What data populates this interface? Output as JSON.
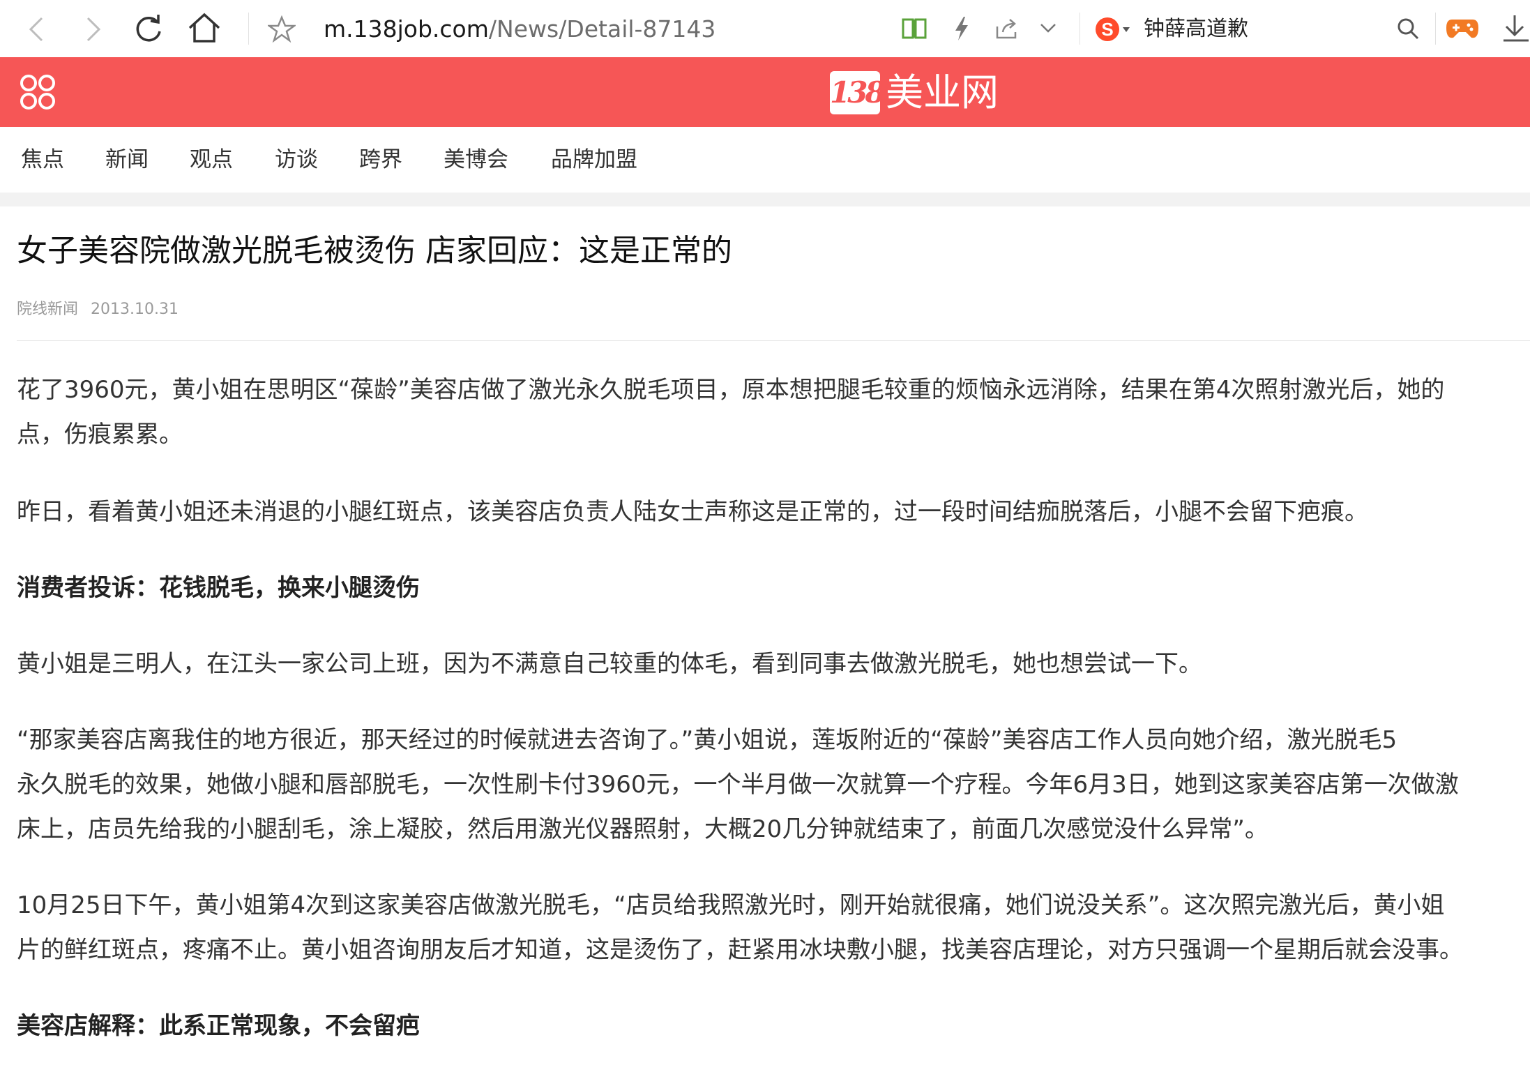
{
  "browser": {
    "url_host": "m.138job.com",
    "url_path": "/News/Detail-87143",
    "search_suggestion": "钟薛高道歉",
    "search_engine_icon": "sogou-s-icon",
    "icons": [
      "back-icon",
      "forward-icon",
      "reload-icon",
      "home-icon",
      "star-icon",
      "reader-icon",
      "lightning-icon",
      "share-icon",
      "chevron-down-icon",
      "search-icon",
      "game-icon",
      "download-icon"
    ]
  },
  "site": {
    "brand_number": "138",
    "brand_name": "美业网",
    "accent_color": "#f65656",
    "menu_icon": "apps-menu-icon"
  },
  "nav": {
    "items": [
      "焦点",
      "新闻",
      "观点",
      "访谈",
      "跨界",
      "美博会",
      "品牌加盟"
    ]
  },
  "article": {
    "title": "女子美容院做激光脱毛被烫伤 店家回应：这是正常的",
    "source": "院线新闻",
    "date": "2013.10.31",
    "lines": [
      "花了3960元，黄小姐在思明区“葆龄”美容店做了激光永久脱毛项目，原本想把腿毛较重的烦恼永远消除，结果在第4次照射激光后，她的",
      "点，伤痕累累。",
      "昨日，看着黄小姐还未消退的小腿红斑点，该美容店负责人陆女士声称这是正常的，过一段时间结痂脱落后，小腿不会留下疤痕。",
      "消费者投诉：花钱脱毛，换来小腿烫伤",
      "黄小姐是三明人，在江头一家公司上班，因为不满意自己较重的体毛，看到同事去做激光脱毛，她也想尝试一下。",
      "“那家美容店离我住的地方很近，那天经过的时候就进去咨询了。”黄小姐说，莲坂附近的“葆龄”美容店工作人员向她介绍，激光脱毛5",
      "永久脱毛的效果，她做小腿和唇部脱毛，一次性刷卡付3960元，一个半月做一次就算一个疗程。今年6月3日，她到这家美容店第一次做激",
      "床上，店员先给我的小腿刮毛，涂上凝胶，然后用激光仪器照射，大概20几分钟就结束了，前面几次感觉没什么异常”。",
      "10月25日下午，黄小姐第4次到这家美容店做激光脱毛，“店员给我照激光时，刚开始就很痛，她们说没关系”。这次照完激光后，黄小姐",
      "片的鲜红斑点，疼痛不止。黄小姐咨询朋友后才知道，这是烫伤了，赶紧用冰块敷小腿，找美容店理论，对方只强调一个星期后就会没事。",
      "美容店解释：此系正常现象，不会留疤"
    ]
  }
}
